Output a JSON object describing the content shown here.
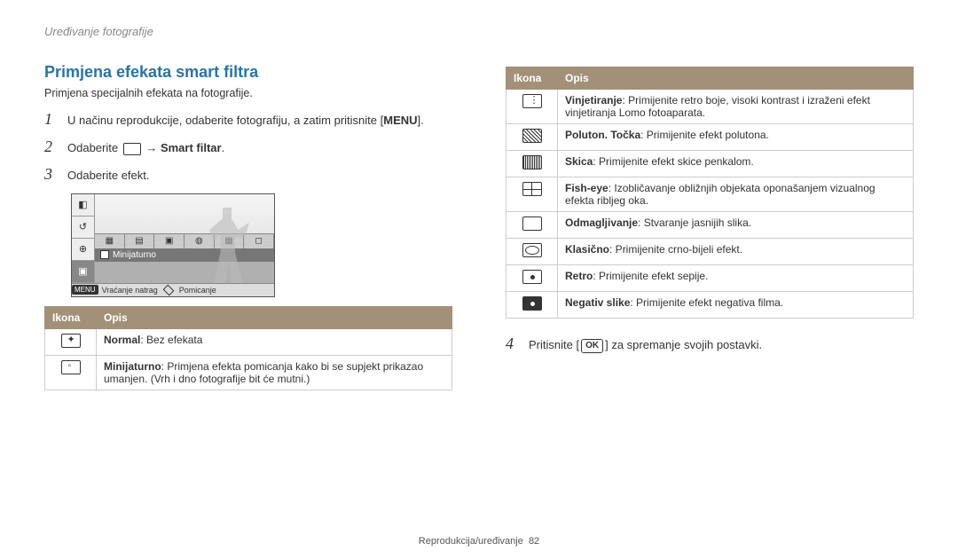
{
  "header_note": "Uređivanje fotografije",
  "section_title": "Primjena efekata smart filtra",
  "intro": "Primjena specijalnih efekata na fotografije.",
  "steps": {
    "s1": "U načinu reprodukcije, odaberite fotografiju, a zatim pritisnite",
    "s1_btn": "MENU",
    "s2_a": "Odaberite ",
    "s2_b": " → ",
    "s2_c": "Smart filtar",
    "s3": "Odaberite efekt.",
    "s4_a": "Pritisnite ",
    "s4_ok": "OK",
    "s4_b": " za spremanje svojih postavki."
  },
  "mock": {
    "label": "Minijaturno",
    "menu": "MENU",
    "back": "Vraćanje natrag",
    "move": "Pomicanje"
  },
  "table_headers": {
    "icon": "Ikona",
    "desc": "Opis"
  },
  "left_rows": [
    {
      "icon": "star",
      "name": "Normal",
      "desc": ": Bez efekata"
    },
    {
      "icon": "mini",
      "name": "Minijaturno",
      "desc": ": Primjena efekta pomicanja kako bi se supjekt prikazao umanjen. (Vrh i dno fotografije bit će mutni.)"
    }
  ],
  "right_rows": [
    {
      "icon": "dots",
      "name": "Vinjetiranje",
      "desc": ": Primijenite retro boje, visoki kontrast i izraženi efekt vinjetiranja Lomo fotoaparata."
    },
    {
      "icon": "halftone",
      "name": "Poluton. Točka",
      "desc": ": Primijenite efekt polutona."
    },
    {
      "icon": "sketch",
      "name": "Skica",
      "desc": ": Primijenite efekt skice penkalom."
    },
    {
      "icon": "grid",
      "name": "Fish-eye",
      "desc": ": Izobličavanje obližnjih objekata oponašanjem vizualnog efekta ribljeg oka."
    },
    {
      "icon": "plain",
      "name": "Odmagljivanje",
      "desc": ": Stvaranje jasnijih slika."
    },
    {
      "icon": "circle",
      "name": "Klasično",
      "desc": ": Primijenite crno-bijeli efekt."
    },
    {
      "icon": "dot",
      "name": "Retro",
      "desc": ": Primijenite efekt sepije."
    },
    {
      "icon": "neg",
      "name": "Negativ slike",
      "desc": ": Primijenite efekt negativa filma."
    }
  ],
  "footer": {
    "section": "Reprodukcija/uređivanje",
    "page": "82"
  }
}
